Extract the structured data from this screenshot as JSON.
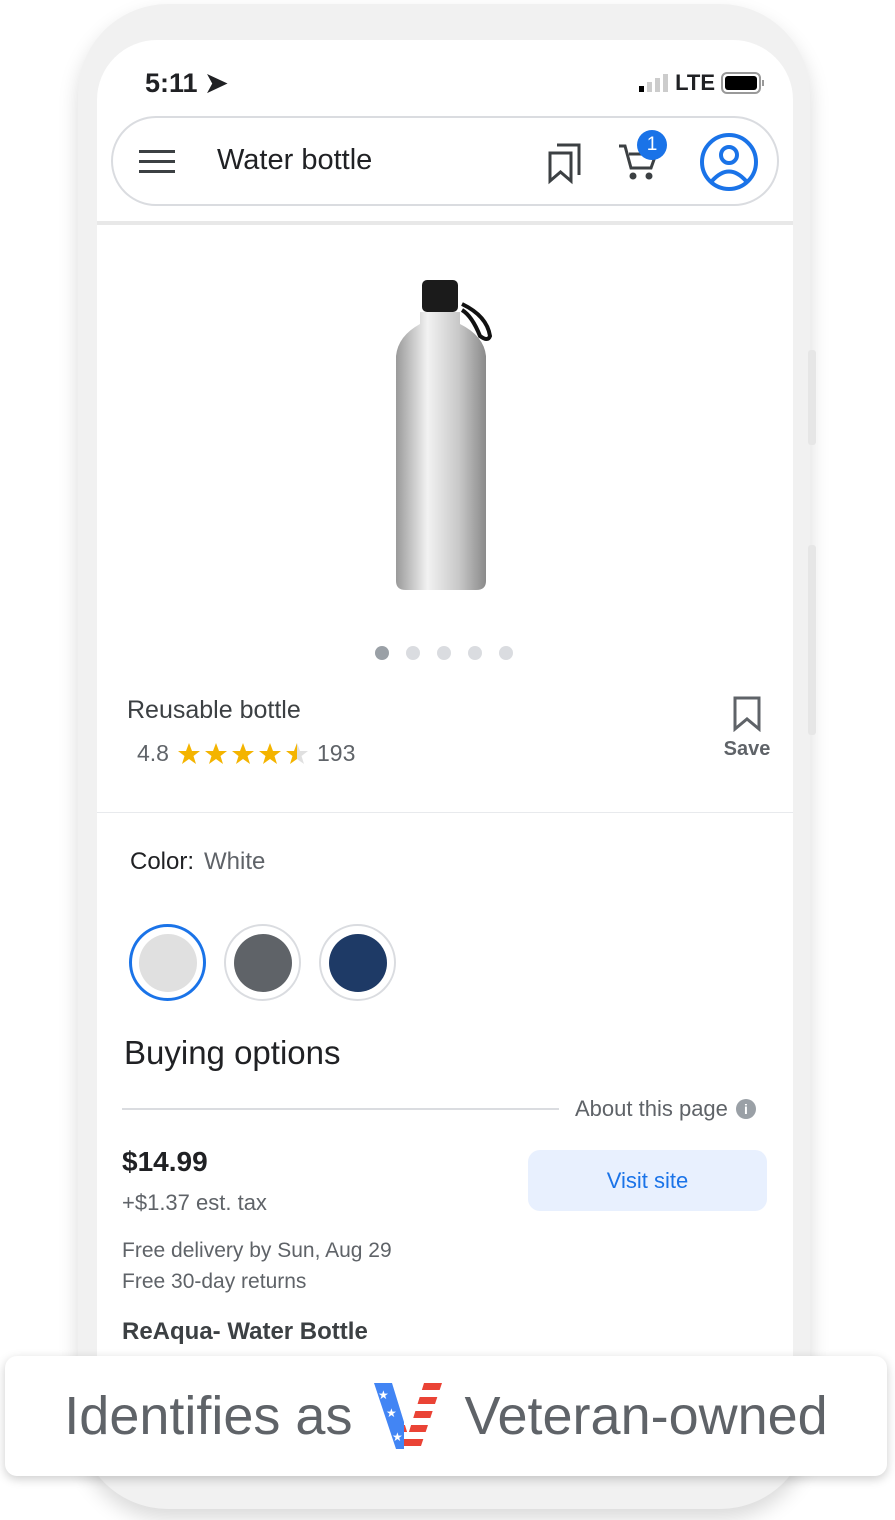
{
  "status": {
    "time": "5:11",
    "network": "LTE"
  },
  "search": {
    "query": "Water bottle",
    "cart_count": "1"
  },
  "product": {
    "image_dots": 5,
    "active_dot": 0,
    "title": "Reusable bottle",
    "rating": "4.8",
    "rating_value": 4.5,
    "reviews": "193",
    "save_label": "Save"
  },
  "color": {
    "label": "Color:",
    "value": "White",
    "swatches": [
      "#e0e0e0",
      "#5f6368",
      "#1e3a66"
    ],
    "selected": 0
  },
  "buying": {
    "heading": "Buying options",
    "about": "About this page",
    "price": "$14.99",
    "tax": "+$1.37 est. tax",
    "delivery": "Free delivery by Sun, Aug 29",
    "returns": "Free 30-day returns",
    "visit_label": "Visit site",
    "seller": "ReAqua- Water Bottle"
  },
  "banner": {
    "prefix": "Identifies as",
    "suffix": "Veteran-owned"
  },
  "colors": {
    "accent": "#1a73e8",
    "star": "#f4b400"
  }
}
